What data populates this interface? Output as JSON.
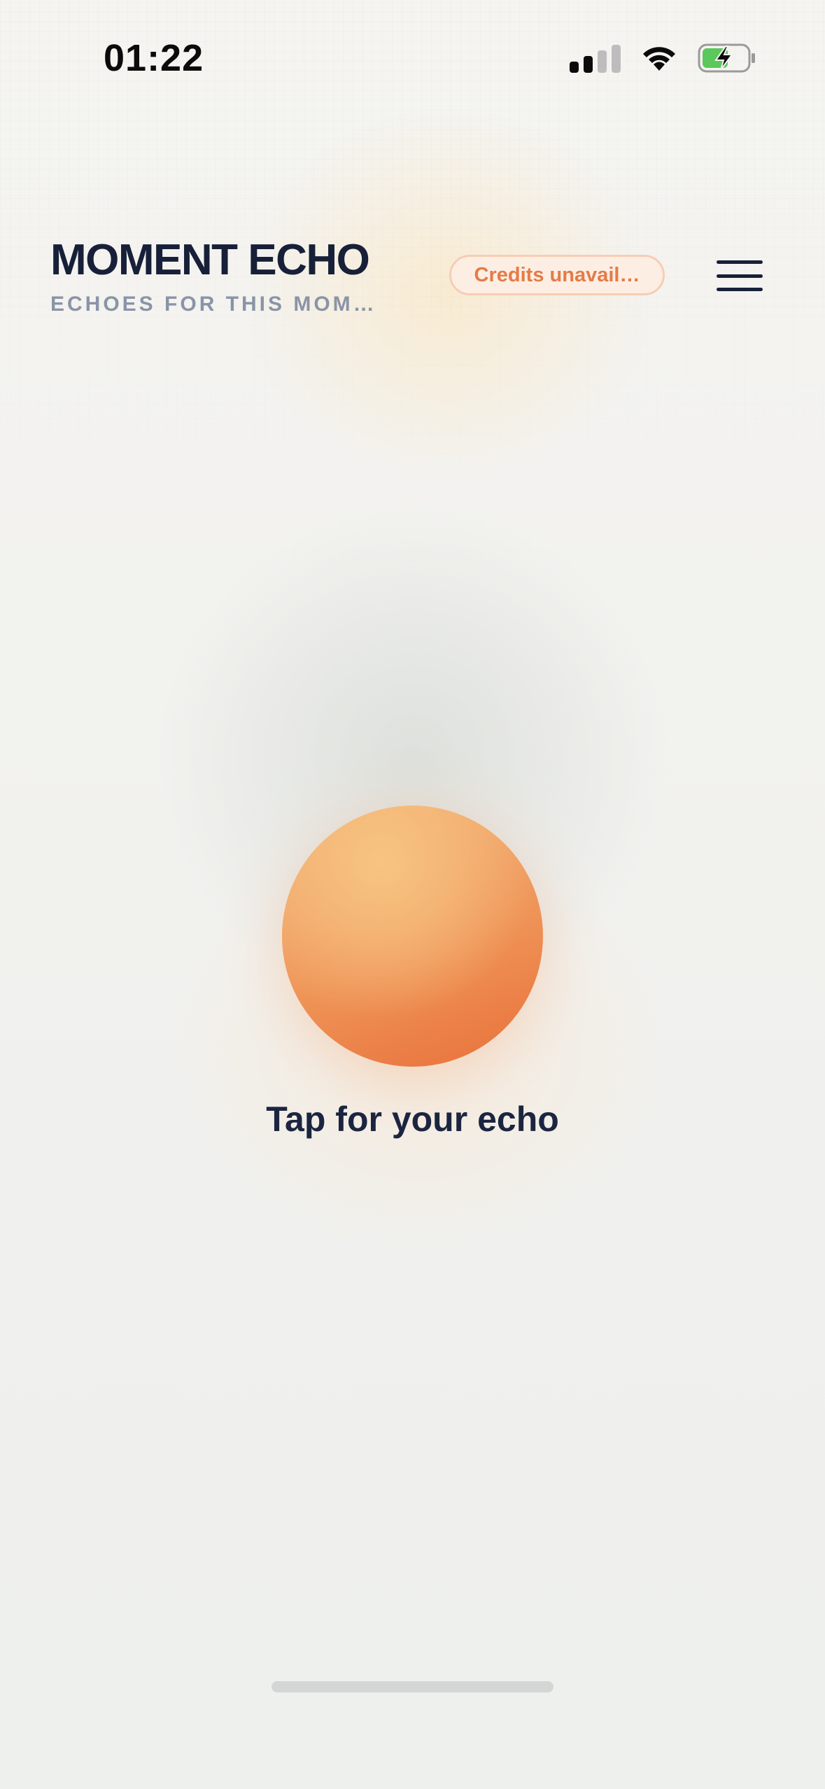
{
  "status_bar": {
    "time": "01:22",
    "signal_icon": "cellular-signal-icon",
    "wifi_icon": "wifi-icon",
    "battery_icon": "battery-charging-icon"
  },
  "header": {
    "title": "MOMENT ECHO",
    "subtitle": "ECHOES FOR THIS MOM…",
    "credits_badge": "Credits unavail…",
    "menu_icon": "hamburger-menu-icon"
  },
  "main": {
    "orb_icon": "echo-orb",
    "tap_label": "Tap for your echo"
  },
  "colors": {
    "title": "#172038",
    "subtitle": "#8a94a6",
    "badge_text": "#e57b47",
    "badge_bg": "#fdeee4",
    "orb_light": "#f3b27a",
    "orb_dark": "#e8703a"
  }
}
